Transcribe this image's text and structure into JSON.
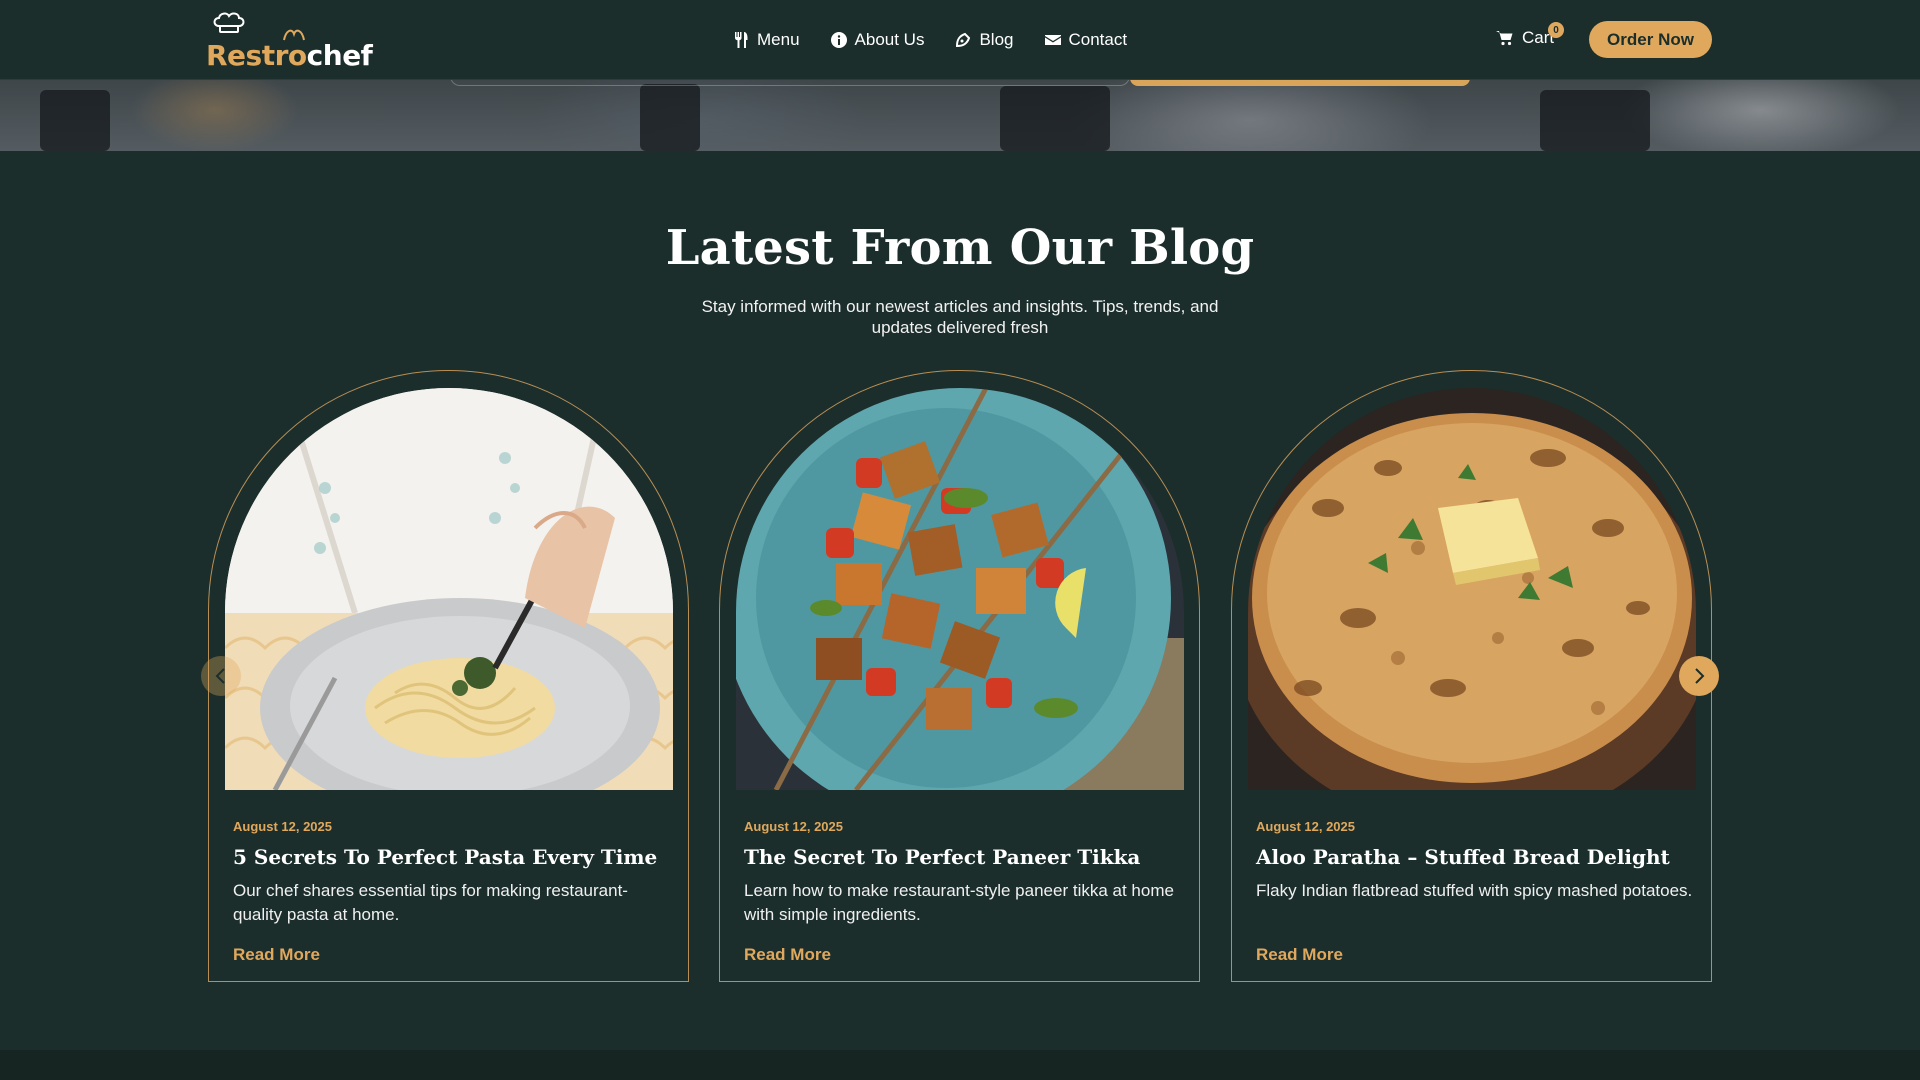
{
  "brand": {
    "logo_part1": "Restro",
    "logo_part2": "chef",
    "accent": "#e0a85c",
    "background": "#1b2e2c"
  },
  "nav": {
    "items": [
      {
        "label": "Menu",
        "icon": "utensils-icon"
      },
      {
        "label": "About Us",
        "icon": "info-icon"
      },
      {
        "label": "Blog",
        "icon": "blog-icon"
      },
      {
        "label": "Contact",
        "icon": "envelope-icon"
      }
    ],
    "cart_label": "Cart",
    "cart_count": "0",
    "order_label": "Order Now"
  },
  "blog": {
    "title": "Latest From Our Blog",
    "subtitle": "Stay informed with our newest articles and insights. Tips, trends, and updates delivered fresh",
    "posts": [
      {
        "date": "August 12, 2025",
        "title": "5 Secrets To Perfect Pasta Every Time",
        "description": "Our chef shares essential tips for making restaurant-quality pasta at home.",
        "link": "Read More"
      },
      {
        "date": "August 12, 2025",
        "title": "The Secret To Perfect Paneer Tikka",
        "description": "Learn how to make restaurant-style paneer tikka at home with simple ingredients.",
        "link": "Read More"
      },
      {
        "date": "August 12, 2025",
        "title": "Aloo Paratha – Stuffed Bread Delight",
        "description": "Flaky Indian flatbread stuffed with spicy mashed potatoes.",
        "link": "Read More"
      }
    ]
  }
}
